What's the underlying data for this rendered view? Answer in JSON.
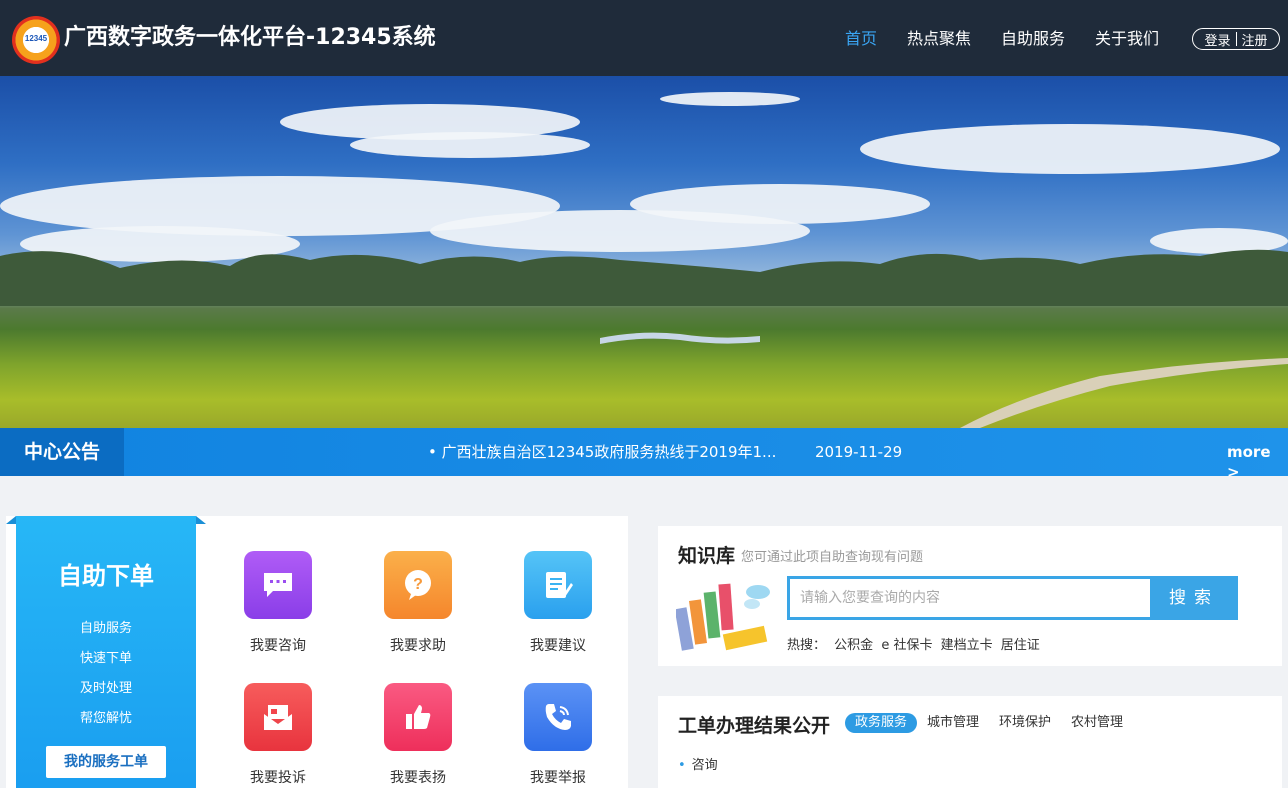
{
  "header": {
    "logo_text": "12345",
    "site_title": "广西数字政务一体化平台-12345系统",
    "nav": [
      {
        "label": "首页",
        "active": true
      },
      {
        "label": "热点聚焦",
        "active": false
      },
      {
        "label": "自助服务",
        "active": false
      },
      {
        "label": "关于我们",
        "active": false
      }
    ],
    "login_label": "登录",
    "register_label": "注册"
  },
  "notice": {
    "label": "中心公告",
    "text": "• 广西壮族自治区12345政府服务热线于2019年1...",
    "date": "2019-11-29",
    "more": "more >"
  },
  "self_service": {
    "title": "自助下单",
    "items": [
      "自助服务",
      "快速下单",
      "及时处理",
      "帮您解忧"
    ],
    "button": "我的服务工单"
  },
  "services": [
    {
      "label": "我要咨询",
      "icon": "chat-icon",
      "color": "#9b4ef0"
    },
    {
      "label": "我要求助",
      "icon": "question-icon",
      "color": "#f79a3b"
    },
    {
      "label": "我要建议",
      "icon": "edit-icon",
      "color": "#3bb3f2"
    },
    {
      "label": "我要投诉",
      "icon": "mail-icon",
      "color": "#f2454d"
    },
    {
      "label": "我要表扬",
      "icon": "thumbs-up-icon",
      "color": "#f43f6b"
    },
    {
      "label": "我要举报",
      "icon": "phone-icon",
      "color": "#3a7ef0"
    }
  ],
  "knowledge": {
    "title": "知识库",
    "subtitle": "您可通过此项自助查询现有问题",
    "placeholder": "请输入您要查询的内容",
    "search_label": "搜索",
    "hot_label": "热搜：",
    "hot_terms": [
      "公积金",
      "e 社保卡",
      "建档立卡",
      "居住证"
    ]
  },
  "work_orders": {
    "title": "工单办理结果公开",
    "tabs": [
      {
        "label": "政务服务",
        "active": true
      },
      {
        "label": "城市管理",
        "active": false
      },
      {
        "label": "环境保护",
        "active": false
      },
      {
        "label": "农村管理",
        "active": false
      }
    ],
    "items": [
      "咨询"
    ]
  }
}
